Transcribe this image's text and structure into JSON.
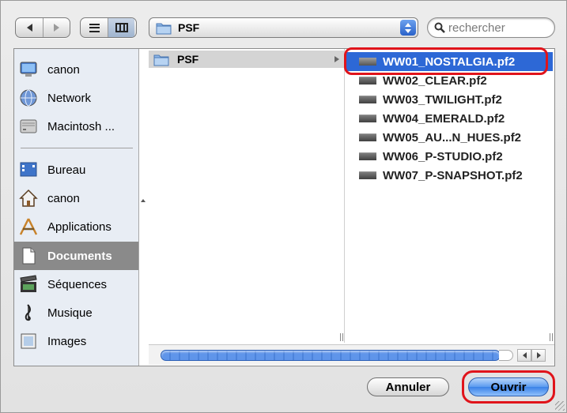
{
  "toolbar": {
    "back_icon": "back-arrow",
    "forward_icon": "forward-arrow",
    "list_view_icon": "list-view",
    "column_view_icon": "column-view",
    "path": "PSF",
    "search_placeholder": "rechercher"
  },
  "sidebar": {
    "devices": [
      {
        "label": "canon",
        "icon": "computer-icon"
      },
      {
        "label": "Network",
        "icon": "network-icon"
      },
      {
        "label": "Macintosh ...",
        "icon": "hard-drive-icon"
      }
    ],
    "places": [
      {
        "label": "Bureau",
        "icon": "desktop-icon"
      },
      {
        "label": "canon",
        "icon": "home-icon"
      },
      {
        "label": "Applications",
        "icon": "applications-icon"
      },
      {
        "label": "Documents",
        "icon": "documents-icon",
        "selected": true
      },
      {
        "label": "Séquences",
        "icon": "movies-icon"
      },
      {
        "label": "Musique",
        "icon": "music-icon"
      },
      {
        "label": "Images",
        "icon": "pictures-icon"
      }
    ]
  },
  "column1": {
    "items": [
      {
        "label": "PSF",
        "icon": "folder-icon"
      }
    ]
  },
  "column2": {
    "files": [
      {
        "label": "WW01_NOSTALGIA.pf2",
        "selected": true
      },
      {
        "label": "WW02_CLEAR.pf2"
      },
      {
        "label": "WW03_TWILIGHT.pf2"
      },
      {
        "label": "WW04_EMERALD.pf2"
      },
      {
        "label": "WW05_AU...N_HUES.pf2"
      },
      {
        "label": "WW06_P-STUDIO.pf2"
      },
      {
        "label": "WW07_P-SNAPSHOT.pf2"
      }
    ]
  },
  "buttons": {
    "cancel": "Annuler",
    "open": "Ouvrir"
  },
  "colors": {
    "selection": "#2d68d6",
    "highlight_ring": "#e0141b",
    "sidebar_bg": "#e8edf4"
  }
}
